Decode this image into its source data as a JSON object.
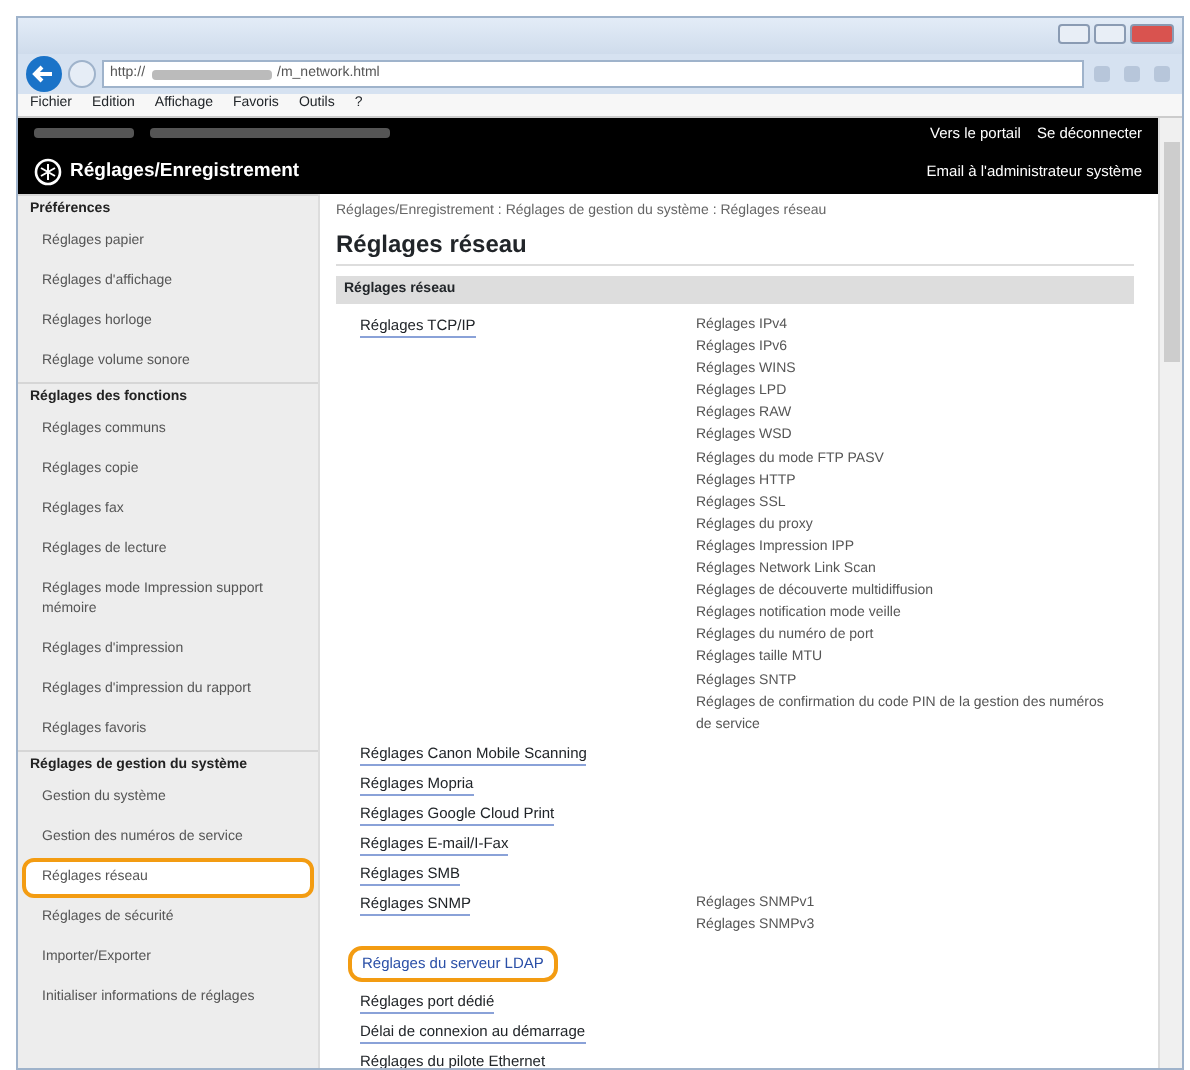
{
  "browser": {
    "url_start": "http://",
    "url_end": "/m_network.html",
    "menu": [
      "Fichier",
      "Edition",
      "Affichage",
      "Favoris",
      "Outils",
      "?"
    ]
  },
  "header": {
    "title": "Réglages/Enregistrement",
    "links": [
      "Vers le portail",
      "Se déconnecter"
    ],
    "email": "Email à l'administrateur système"
  },
  "sidebar": [
    {
      "heading": "Préférences",
      "items": [
        {
          "label": "Réglages papier",
          "highlighted": false
        },
        {
          "label": "Réglages d'affichage",
          "highlighted": false
        },
        {
          "label": "Réglages horloge",
          "highlighted": false
        },
        {
          "label": "Réglage volume sonore",
          "highlighted": false
        }
      ]
    },
    {
      "heading": "Réglages des fonctions",
      "items": [
        {
          "label": "Réglages communs",
          "highlighted": false
        },
        {
          "label": "Réglages copie",
          "highlighted": false
        },
        {
          "label": "Réglages fax",
          "highlighted": false
        },
        {
          "label": "Réglages de lecture",
          "highlighted": false
        },
        {
          "label": "Réglages mode Impression support mémoire",
          "highlighted": false
        },
        {
          "label": "Réglages d'impression",
          "highlighted": false
        },
        {
          "label": "Réglages d'impression du rapport",
          "highlighted": false
        },
        {
          "label": "Réglages favoris",
          "highlighted": false
        }
      ]
    },
    {
      "heading": "Réglages de gestion du système",
      "items": [
        {
          "label": "Gestion du système",
          "highlighted": false
        },
        {
          "label": "Gestion des numéros de service",
          "highlighted": false
        },
        {
          "label": "Réglages réseau",
          "highlighted": true
        },
        {
          "label": "Réglages de sécurité",
          "highlighted": false
        },
        {
          "label": "Importer/Exporter",
          "highlighted": false
        },
        {
          "label": "Initialiser informations de réglages",
          "highlighted": false
        }
      ]
    }
  ],
  "breadcrumb": "Réglages/Enregistrement : Réglages de gestion du système : Réglages réseau",
  "page_title": "Réglages réseau",
  "section_title": "Réglages réseau",
  "settings": [
    {
      "label": "Réglages TCP/IP",
      "highlighted": false,
      "sub": [
        "Réglages IPv4",
        "Réglages IPv6",
        "Réglages WINS",
        "Réglages LPD",
        "Réglages RAW",
        "Réglages WSD",
        "Réglages du mode FTP PASV",
        "Réglages HTTP",
        "Réglages SSL",
        "Réglages du proxy",
        "Réglages Impression IPP",
        "Réglages Network Link Scan",
        "Réglages de découverte multidiffusion",
        "Réglages notification mode veille",
        "Réglages du numéro de port",
        "Réglages taille MTU",
        "Réglages SNTP",
        "Réglages de confirmation du code PIN de la gestion des numéros de service"
      ]
    },
    {
      "label": "Réglages Canon Mobile Scanning",
      "highlighted": false
    },
    {
      "label": "Réglages Mopria",
      "highlighted": false
    },
    {
      "label": "Réglages Google Cloud Print",
      "highlighted": false
    },
    {
      "label": "Réglages E-mail/I-Fax",
      "highlighted": false
    },
    {
      "label": "Réglages SMB",
      "highlighted": false
    },
    {
      "label": "Réglages SNMP",
      "highlighted": false,
      "sub": [
        "Réglages SNMPv1",
        "Réglages SNMPv3"
      ]
    },
    {
      "label": "Réglages du serveur LDAP",
      "highlighted": true
    },
    {
      "label": "Réglages port dédié",
      "highlighted": false
    },
    {
      "label": "Délai de connexion au démarrage",
      "highlighted": false
    },
    {
      "label": "Réglages du pilote Ethernet",
      "highlighted": false
    }
  ]
}
